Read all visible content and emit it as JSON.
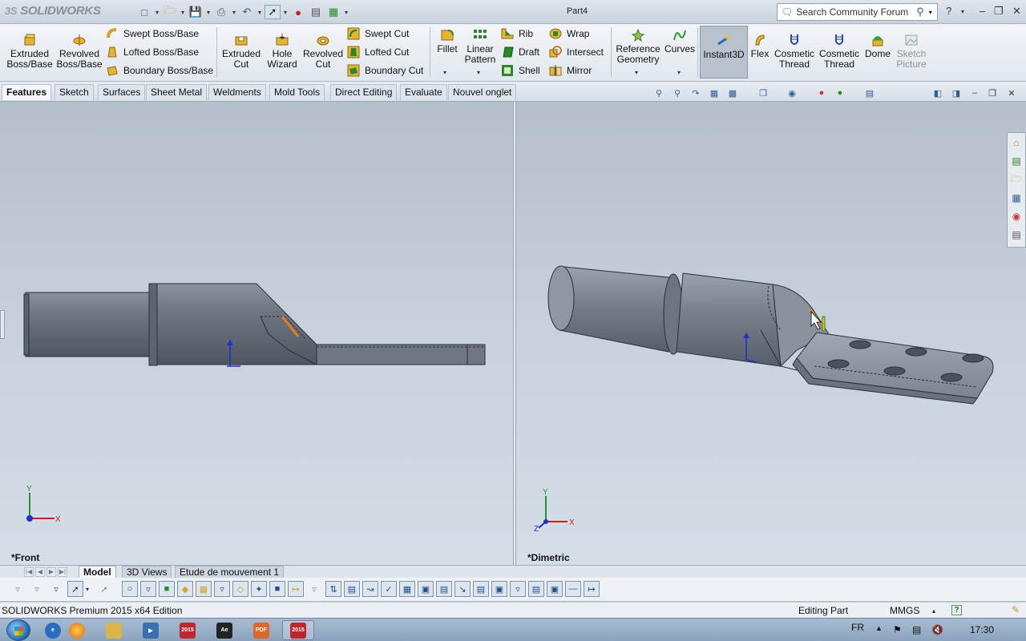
{
  "app": {
    "logo_text": "SOLIDWORKS",
    "logo_prefix": "3S",
    "document_title": "Part4",
    "search_placeholder": "Search Community Forum"
  },
  "ribbon": {
    "large_buttons": [
      {
        "id": "extruded-boss",
        "label": "Extruded Boss/Base",
        "icon": "extrude-icon"
      },
      {
        "id": "revolved-boss",
        "label": "Revolved Boss/Base",
        "icon": "revolve-icon"
      },
      {
        "id": "extruded-cut",
        "label": "Extruded Cut",
        "icon": "extrude-cut-icon"
      },
      {
        "id": "hole-wizard",
        "label": "Hole Wizard",
        "icon": "hole-icon"
      },
      {
        "id": "revolved-cut",
        "label": "Revolved Cut",
        "icon": "revolve-cut-icon"
      },
      {
        "id": "fillet",
        "label": "Fillet",
        "icon": "fillet-icon"
      },
      {
        "id": "linear-pattern",
        "label": "Linear Pattern",
        "icon": "pattern-icon"
      },
      {
        "id": "reference-geometry",
        "label": "Reference Geometry",
        "icon": "reference-icon"
      },
      {
        "id": "curves",
        "label": "Curves",
        "icon": "curves-icon"
      },
      {
        "id": "instant3d",
        "label": "Instant3D",
        "icon": "instant3d-icon"
      },
      {
        "id": "flex",
        "label": "Flex",
        "icon": "flex-icon"
      },
      {
        "id": "cosmetic-thread-1",
        "label": "Cosmetic Thread",
        "icon": "thread-icon"
      },
      {
        "id": "cosmetic-thread-2",
        "label": "Cosmetic Thread",
        "icon": "thread-icon"
      },
      {
        "id": "dome",
        "label": "Dome",
        "icon": "dome-icon"
      },
      {
        "id": "sketch-picture",
        "label": "Sketch Picture",
        "icon": "picture-icon"
      }
    ],
    "small_buttons": [
      {
        "id": "swept-boss",
        "label": "Swept Boss/Base"
      },
      {
        "id": "lofted-boss",
        "label": "Lofted Boss/Base"
      },
      {
        "id": "boundary-boss",
        "label": "Boundary Boss/Base"
      },
      {
        "id": "swept-cut",
        "label": "Swept Cut"
      },
      {
        "id": "lofted-cut",
        "label": "Lofted Cut"
      },
      {
        "id": "boundary-cut",
        "label": "Boundary Cut"
      },
      {
        "id": "rib",
        "label": "Rib"
      },
      {
        "id": "draft",
        "label": "Draft"
      },
      {
        "id": "shell",
        "label": "Shell"
      },
      {
        "id": "wrap",
        "label": "Wrap"
      },
      {
        "id": "intersect",
        "label": "Intersect"
      },
      {
        "id": "mirror",
        "label": "Mirror"
      }
    ]
  },
  "tabs": [
    "Features",
    "Sketch",
    "Surfaces",
    "Sheet Metal",
    "Weldments",
    "Mold Tools",
    "Direct Editing",
    "Evaluate",
    "Nouvel onglet"
  ],
  "viewports": {
    "left_label": "*Front",
    "right_label": "*Dimetric",
    "triad_x": "X",
    "triad_y": "Y",
    "triad_z": "Z"
  },
  "bottom_tabs": [
    "Model",
    "3D Views",
    "Etude de mouvement 1"
  ],
  "status": {
    "left": "SOLIDWORKS Premium 2015 x64 Edition",
    "mode": "Editing Part",
    "units": "MMGS",
    "help": "?"
  },
  "taskbar": {
    "lang": "FR",
    "time": "17:30",
    "apps": [
      {
        "name": "explorer-ie",
        "color": "#2a6cc0",
        "text": ""
      },
      {
        "name": "firefox",
        "color": "#e0661f",
        "text": ""
      },
      {
        "name": "folder",
        "color": "#d9b54a",
        "text": ""
      },
      {
        "name": "media",
        "color": "#3a6fb0",
        "text": "▶"
      },
      {
        "name": "solidworks-2015",
        "color": "#c0262c",
        "text": "2015"
      },
      {
        "name": "ae",
        "color": "#222222",
        "text": "Ae"
      },
      {
        "name": "pdf",
        "color": "#e0672a",
        "text": "PDF"
      },
      {
        "name": "solidworks-2015-b",
        "color": "#c0262c",
        "text": "2015"
      }
    ]
  },
  "colors": {
    "part_fill": "#7c8491",
    "part_dark": "#5e6672",
    "accent_orange": "#f07a16",
    "triad_red": "#d21c1c",
    "triad_green": "#1e9a2a",
    "triad_blue": "#1c2fd0"
  }
}
